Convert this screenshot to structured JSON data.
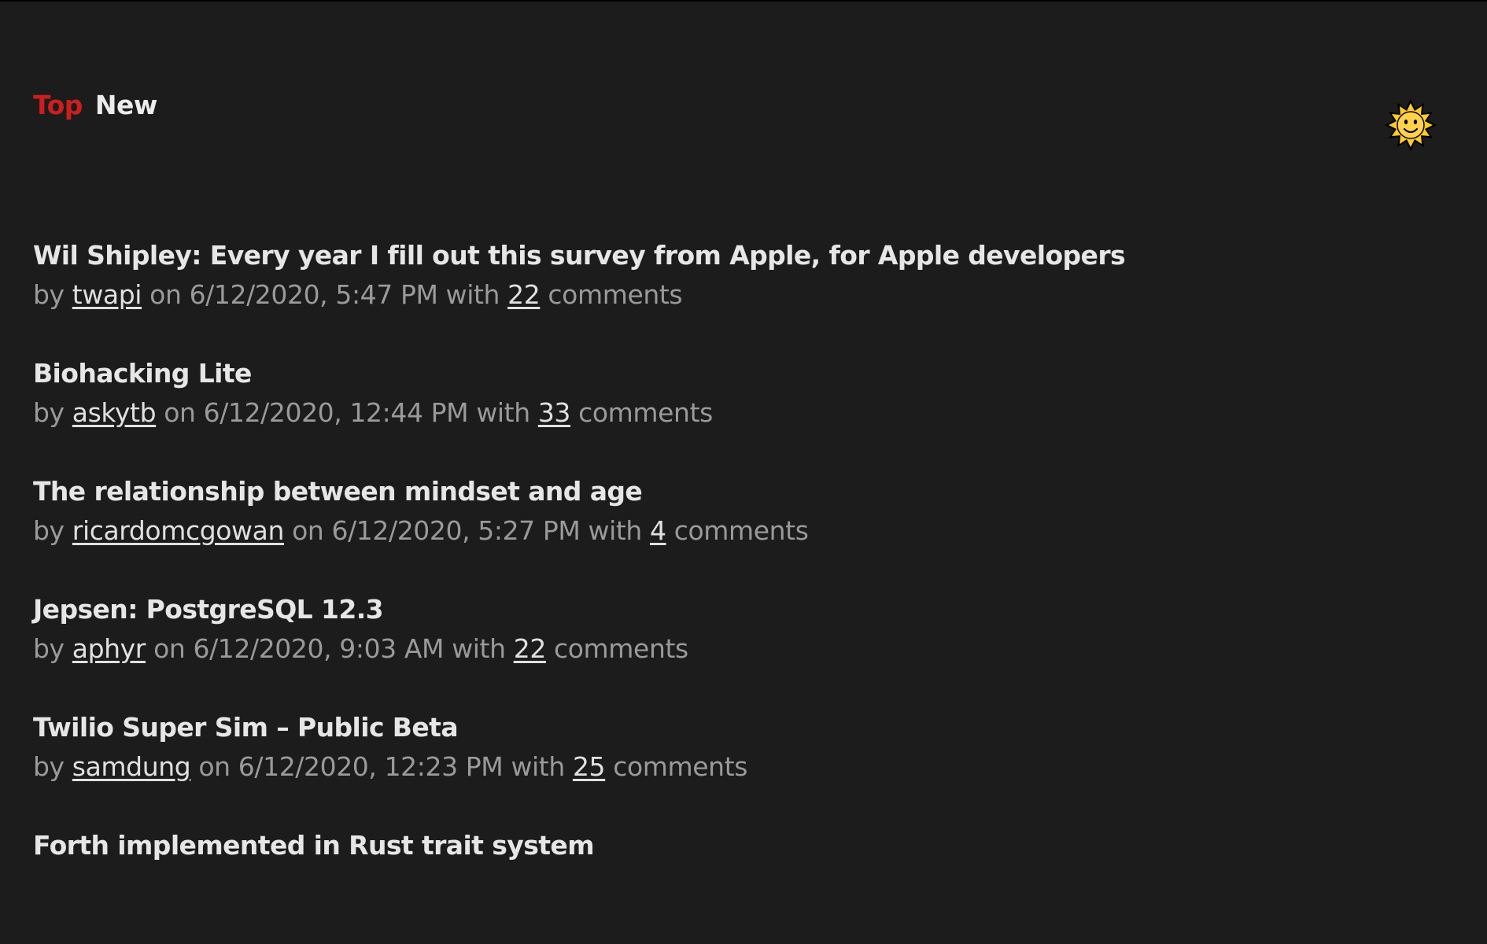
{
  "nav": {
    "tabs": [
      {
        "label": "Top",
        "active": true
      },
      {
        "label": "New",
        "active": false
      }
    ]
  },
  "theme_toggle": {
    "icon": "sun-face-icon",
    "glyph": "🌞"
  },
  "colors": {
    "background": "#1c1c1c",
    "accent": "#cc1e1e",
    "title": "#e6e6e6",
    "meta": "#9a9a9a"
  },
  "meta_words": {
    "by": "by",
    "on": "on",
    "with": "with",
    "comments": "comments"
  },
  "stories": [
    {
      "title": "Wil Shipley: Every year I fill out this survey from Apple, for Apple developers",
      "author": "twapi",
      "date": "6/12/2020, 5:47 PM",
      "comments": "22"
    },
    {
      "title": "Biohacking Lite",
      "author": "askytb",
      "date": "6/12/2020, 12:44 PM",
      "comments": "33"
    },
    {
      "title": "The relationship between mindset and age",
      "author": "ricardomcgowan",
      "date": "6/12/2020, 5:27 PM",
      "comments": "4"
    },
    {
      "title": "Jepsen: PostgreSQL 12.3",
      "author": "aphyr",
      "date": "6/12/2020, 9:03 AM",
      "comments": "22"
    },
    {
      "title": "Twilio Super Sim – Public Beta",
      "author": "samdung",
      "date": "6/12/2020, 12:23 PM",
      "comments": "25"
    },
    {
      "title": "Forth implemented in Rust trait system",
      "author": "",
      "date": "",
      "comments": ""
    }
  ]
}
